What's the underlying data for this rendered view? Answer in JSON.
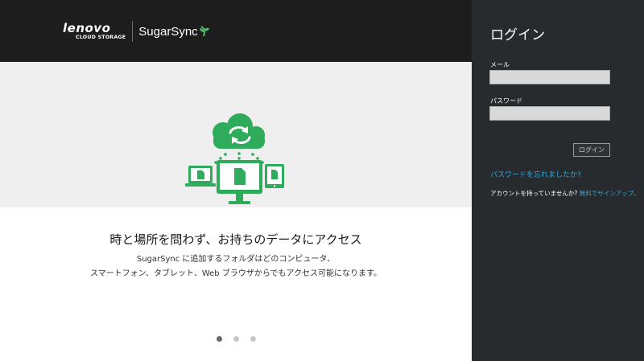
{
  "header": {
    "lenovo_wordmark": "lenovo",
    "lenovo_sub": "CLOUD STORAGE",
    "sugarsync_wordmark": "SugarSync"
  },
  "hero": {
    "headline": "時と場所を問わず、お持ちのデータにアクセス",
    "desc_line1": "SugarSync に追加するフォルダはどのコンピュータ、",
    "desc_line2": "スマートフォン、タブレット、Web ブラウザからでもアクセス可能になります。",
    "slide_count": 3,
    "active_slide": 1,
    "illustration_color": "#2eab5b"
  },
  "login": {
    "title": "ログイン",
    "email_label": "メール",
    "email_value": "",
    "password_label": "パスワード",
    "password_value": "",
    "submit_label": "ログイン",
    "forgot_link": "パスワードを忘れましたか?",
    "no_account_text": "アカウントを持っていませんか?",
    "signup_link": "無料でサインアップ。"
  },
  "colors": {
    "panel_bg": "#272b2d",
    "header_bg": "#1d1d1d",
    "link": "#2fa6de",
    "accent_green": "#2eab5b"
  }
}
